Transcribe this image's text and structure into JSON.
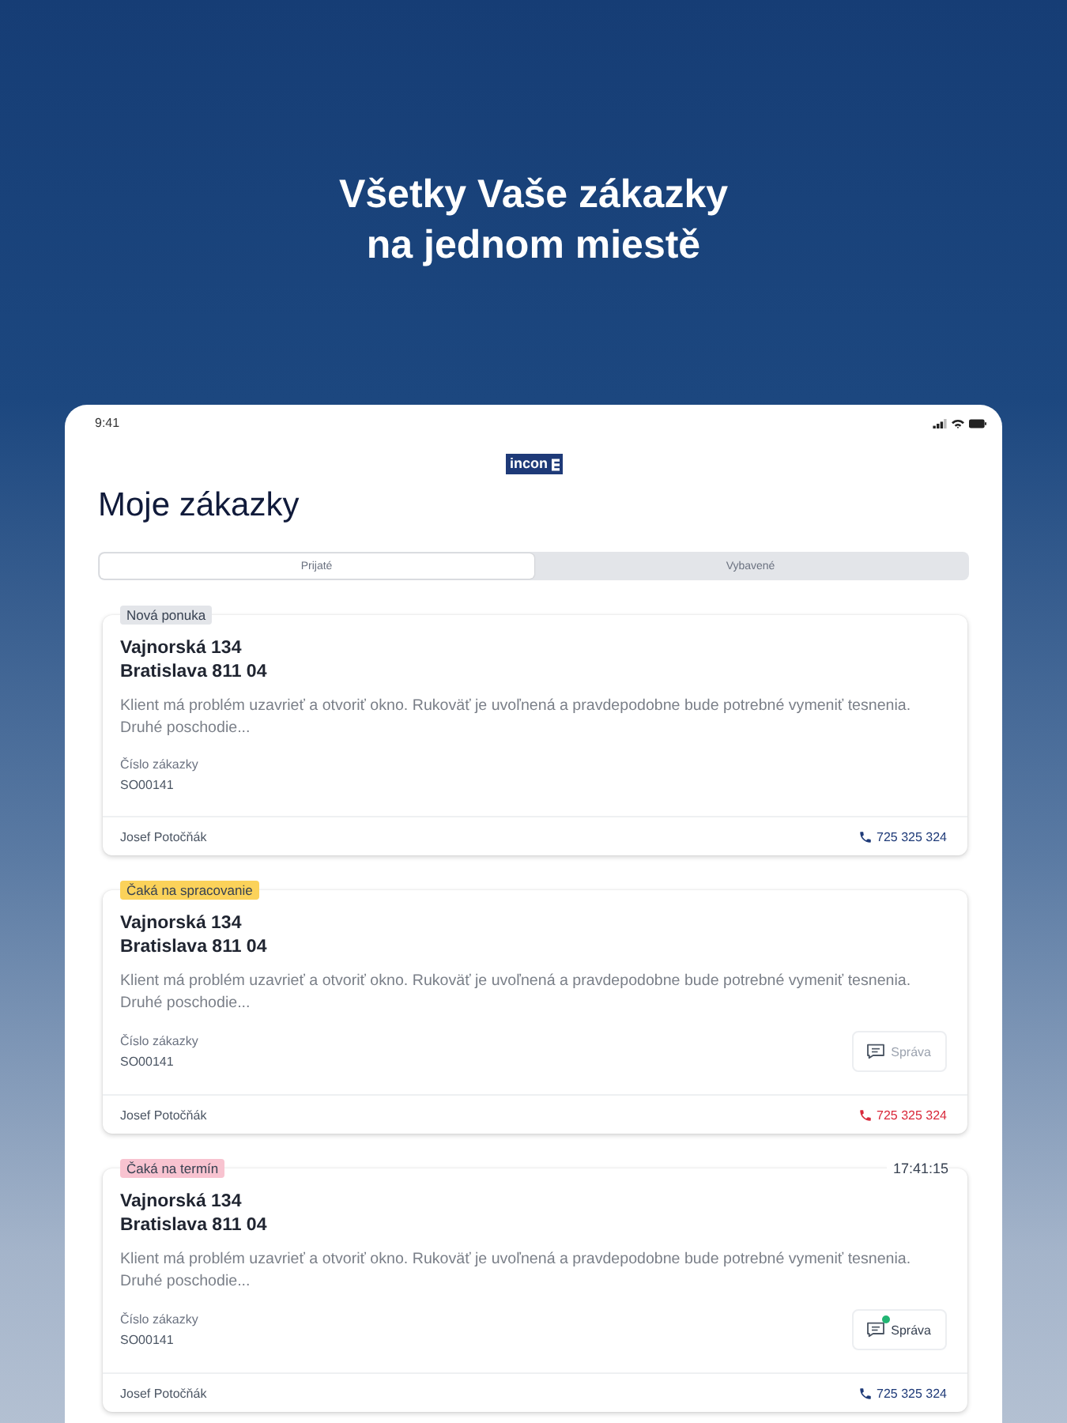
{
  "headline": "Všetky Vaše zákazky na jednom miestě",
  "status_bar": {
    "time": "9:41"
  },
  "logo": {
    "text": "incon"
  },
  "page_title": "Moje zákazky",
  "tabs": [
    {
      "label": "Prijaté",
      "selected": true
    },
    {
      "label": "Vybavené",
      "selected": false
    }
  ],
  "orders": [
    {
      "badge": {
        "text": "Nová ponuka",
        "color": "#e3e5e9"
      },
      "street": "Vajnorská 134",
      "city": "Bratislava 811 04",
      "description": "Klient má problém uzavrieť a otvoriť okno. Rukoväť je uvoľnená a pravdepodobne bude potrebné vymeniť tesnenia. Druhé poschodie...",
      "number_label": "Číslo zákazky",
      "number": "SO00141",
      "customer": "Josef Potočňák",
      "phone": {
        "number": "725 325 324",
        "color": "#1e3a78"
      }
    },
    {
      "badge": {
        "text": "Čaká na spracovanie",
        "color": "#fbd25a"
      },
      "street": "Vajnorská 134",
      "city": "Bratislava 811 04",
      "description": "Klient má problém uzavrieť a otvoriť okno. Rukoväť je uvoľnená a pravdepodobne bude potrebné vymeniť tesnenia. Druhé poschodie...",
      "number_label": "Číslo zákazky",
      "number": "SO00141",
      "message_button": {
        "label": "Správa",
        "unread": false
      },
      "customer": "Josef Potočňák",
      "phone": {
        "number": "725 325 324",
        "color": "#d9293b"
      }
    },
    {
      "badge": {
        "text": "Čaká na termín",
        "color": "#f8c3d0"
      },
      "time": "17:41:15",
      "street": "Vajnorská 134",
      "city": "Bratislava 811 04",
      "description": "Klient má problém uzavrieť a otvoriť okno. Rukoväť je uvoľnená a pravdepodobne bude potrebné vymeniť tesnenia. Druhé poschodie...",
      "number_label": "Číslo zákazky",
      "number": "SO00141",
      "message_button": {
        "label": "Správa",
        "unread": true
      },
      "customer": "Josef Potočňák",
      "phone": {
        "number": "725 325 324",
        "color": "#1e3a78"
      }
    }
  ]
}
